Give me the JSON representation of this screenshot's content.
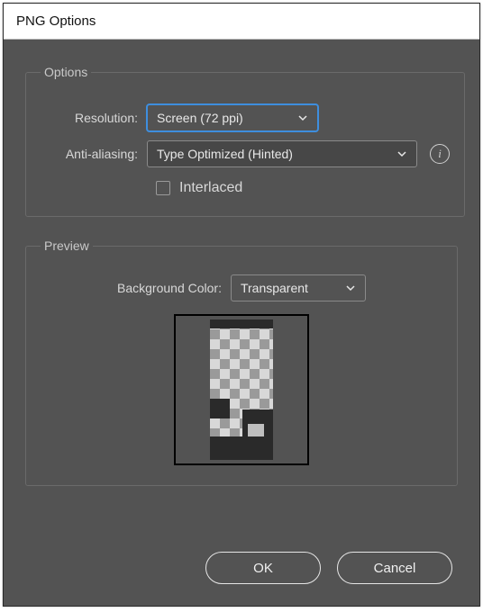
{
  "dialog": {
    "title": "PNG Options"
  },
  "options": {
    "legend": "Options",
    "resolution_label": "Resolution:",
    "resolution_value": "Screen (72 ppi)",
    "antialias_label": "Anti-aliasing:",
    "antialias_value": "Type Optimized (Hinted)",
    "interlaced_label": "Interlaced"
  },
  "preview": {
    "legend": "Preview",
    "bgcolor_label": "Background Color:",
    "bgcolor_value": "Transparent"
  },
  "buttons": {
    "ok": "OK",
    "cancel": "Cancel"
  }
}
